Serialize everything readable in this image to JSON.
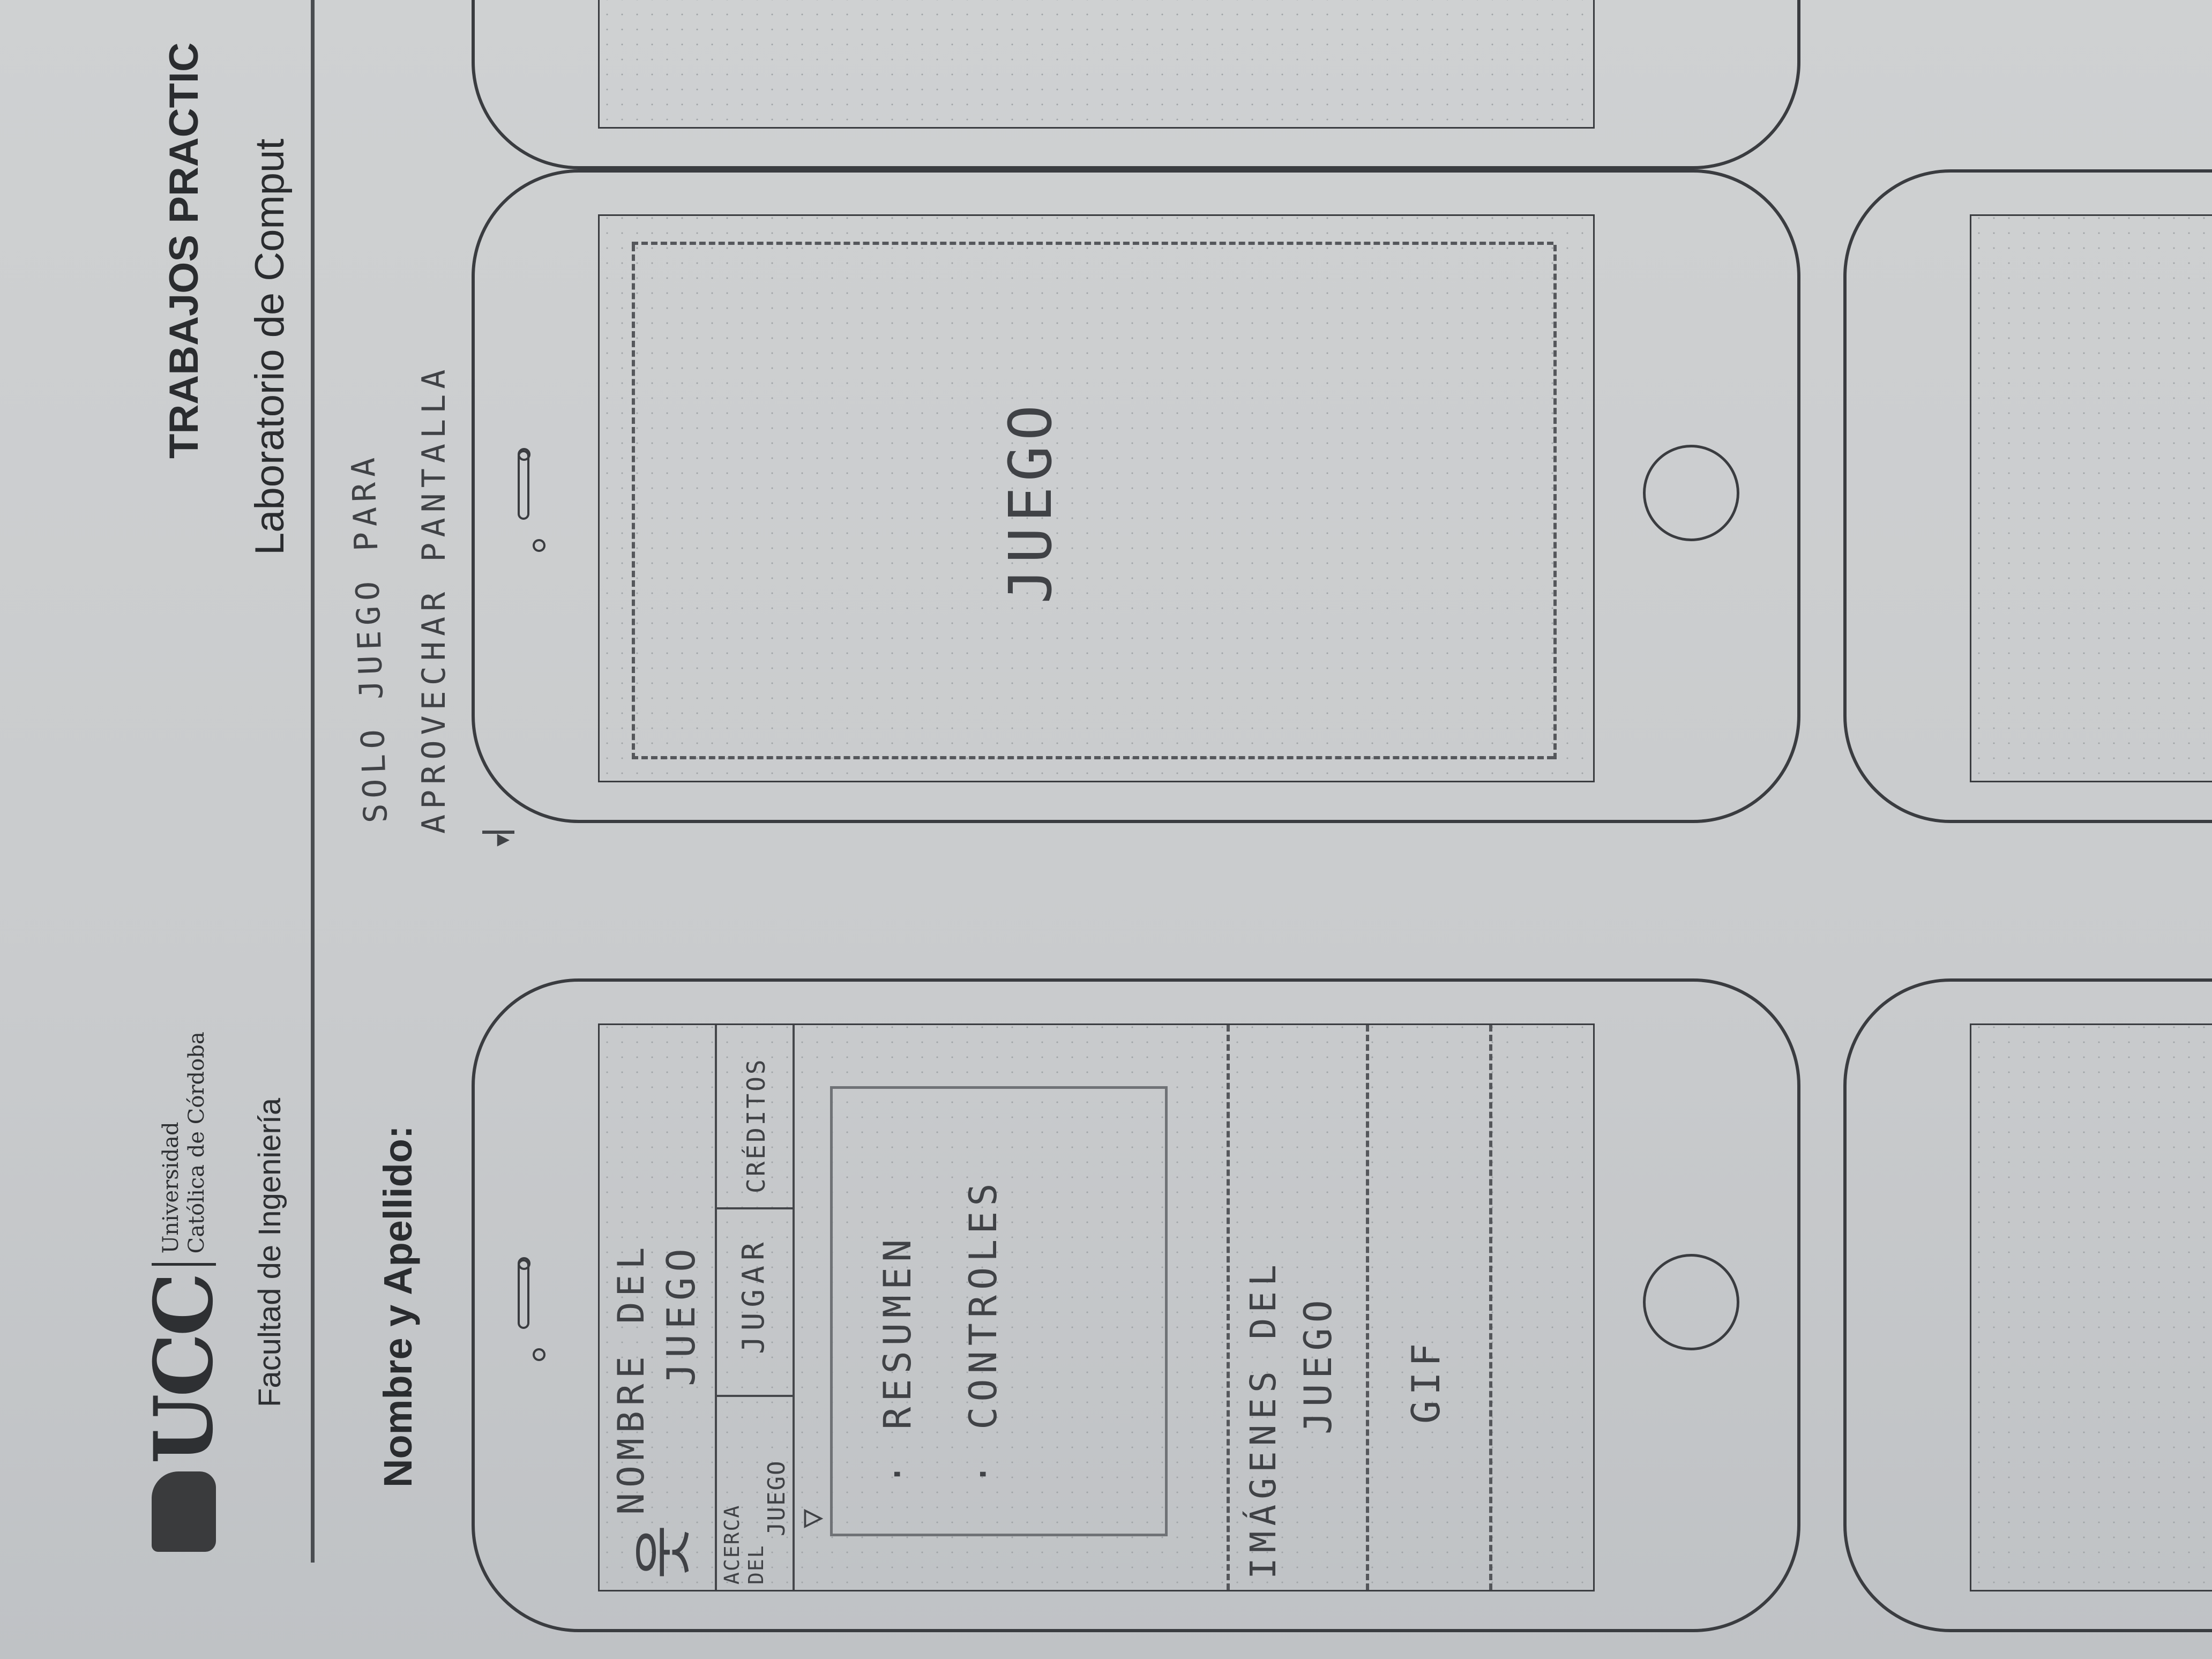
{
  "header": {
    "logo_text": "UCC",
    "university_line1": "Universidad",
    "university_line2": "Católica de Córdoba",
    "faculty": "Facultad de Ingeniería",
    "title": "TRABAJOS PRACTIC",
    "subtitle": "Laboratorio de Comput",
    "name_label": "Nombre y Apellido:"
  },
  "wireframe_home": {
    "title_line1": "NOMBRE  DEL",
    "title_line2": "JUEGO",
    "tab_about_1": "ACERCA",
    "tab_about_2": "DEL",
    "tab_about_3": "JUEGO",
    "tab_play": "JUGAR",
    "tab_credits": "CRÉDITOS",
    "summary": "· RESUMEN",
    "controls": "· CONTROLES",
    "images_line1": "IMÁGENES  DEL",
    "images_line2": "JUEGO",
    "gif": "GIF"
  },
  "wireframe_game": {
    "label": "JUEGO"
  },
  "annotation": {
    "line1": "SOLO JUEGO PARA",
    "line2": "APROVECHAR  PANTALLA"
  }
}
